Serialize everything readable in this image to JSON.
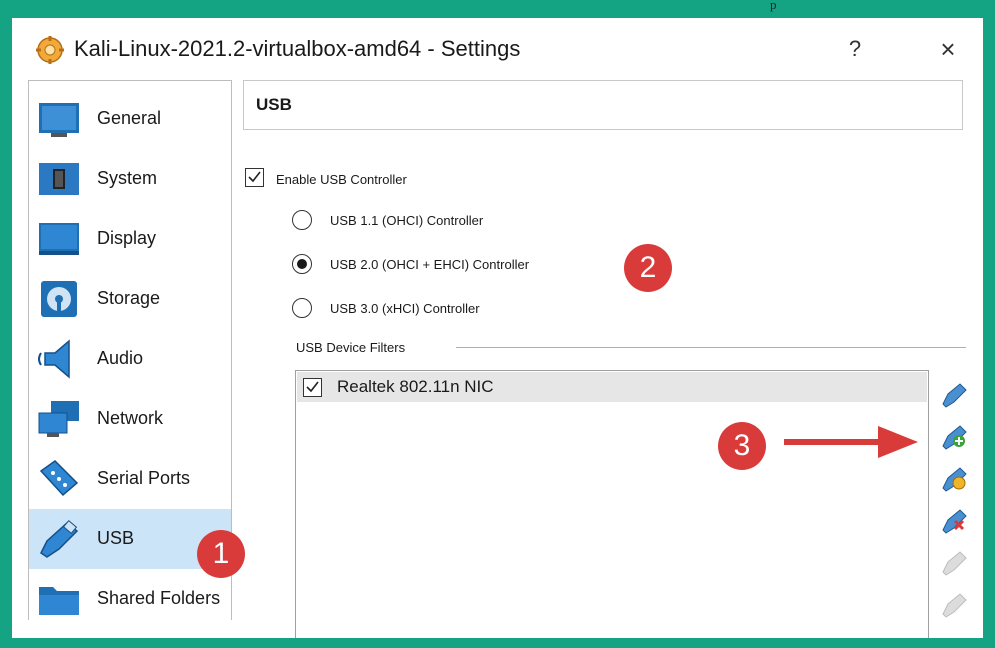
{
  "window": {
    "title": "Kali-Linux-2021.2-virtualbox-amd64 - Settings",
    "help_label": "?",
    "close_label": "×"
  },
  "top_text": "p",
  "sidebar": {
    "items": [
      {
        "label": "General",
        "icon": "general-icon",
        "selected": false
      },
      {
        "label": "System",
        "icon": "system-icon",
        "selected": false
      },
      {
        "label": "Display",
        "icon": "display-icon",
        "selected": false
      },
      {
        "label": "Storage",
        "icon": "storage-icon",
        "selected": false
      },
      {
        "label": "Audio",
        "icon": "audio-icon",
        "selected": false
      },
      {
        "label": "Network",
        "icon": "network-icon",
        "selected": false
      },
      {
        "label": "Serial Ports",
        "icon": "serial-ports-icon",
        "selected": false
      },
      {
        "label": "USB",
        "icon": "usb-icon",
        "selected": true
      },
      {
        "label": "Shared Folders",
        "icon": "shared-folders-icon",
        "selected": false
      }
    ]
  },
  "main": {
    "section_title": "USB",
    "enable_usb": {
      "label": "Enable USB Controller",
      "checked": true
    },
    "controllers": [
      {
        "label": "USB 1.1 (OHCI) Controller",
        "checked": false
      },
      {
        "label": "USB 2.0 (OHCI + EHCI) Controller",
        "checked": true
      },
      {
        "label": "USB 3.0 (xHCI) Controller",
        "checked": false
      }
    ],
    "filters_label": "USB Device Filters",
    "filters": [
      {
        "label": "Realtek 802.11n NIC",
        "checked": true
      }
    ],
    "filter_tools": [
      {
        "icon": "usb-add-empty-filter-icon",
        "enabled": true
      },
      {
        "icon": "usb-add-device-filter-icon",
        "enabled": true
      },
      {
        "icon": "usb-edit-filter-icon",
        "enabled": true
      },
      {
        "icon": "usb-remove-filter-icon",
        "enabled": true
      },
      {
        "icon": "usb-move-up-icon",
        "enabled": false
      },
      {
        "icon": "usb-move-down-icon",
        "enabled": false
      }
    ]
  },
  "annotations": {
    "badge_1": "1",
    "badge_2": "2",
    "badge_3": "3"
  },
  "colors": {
    "frame": "#14a383",
    "selection": "#cce4f7",
    "badge": "#d93b3b",
    "icon_blue": "#1f6fb5"
  }
}
